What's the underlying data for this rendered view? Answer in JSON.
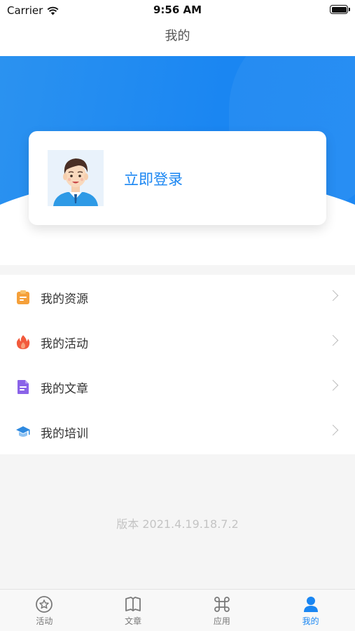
{
  "status_bar": {
    "carrier": "Carrier",
    "time": "9:56 AM",
    "battery_level": 1.0
  },
  "nav": {
    "title": "我的"
  },
  "profile": {
    "login_label": "立即登录",
    "avatar_icon": "user-avatar-illustration"
  },
  "menu": {
    "items": [
      {
        "label": "我的资源",
        "icon": "resource-clipboard-icon",
        "color": "#f5a03a"
      },
      {
        "label": "我的活动",
        "icon": "flame-icon",
        "color": "#f25a3c"
      },
      {
        "label": "我的文章",
        "icon": "document-icon",
        "color": "#8a63e8"
      },
      {
        "label": "我的培训",
        "icon": "graduation-cap-icon",
        "color": "#2f8ae0"
      }
    ]
  },
  "footer": {
    "version_text": "版本  2021.4.19.18.7.2"
  },
  "tabs": [
    {
      "label": "活动",
      "icon": "star-circle-icon",
      "active": false
    },
    {
      "label": "文章",
      "icon": "open-book-icon",
      "active": false
    },
    {
      "label": "应用",
      "icon": "command-apps-icon",
      "active": false
    },
    {
      "label": "我的",
      "icon": "person-icon",
      "active": true
    }
  ],
  "colors": {
    "accent": "#1a86f2",
    "inactive_tab": "#777777",
    "version_text": "#c4c4c4"
  }
}
